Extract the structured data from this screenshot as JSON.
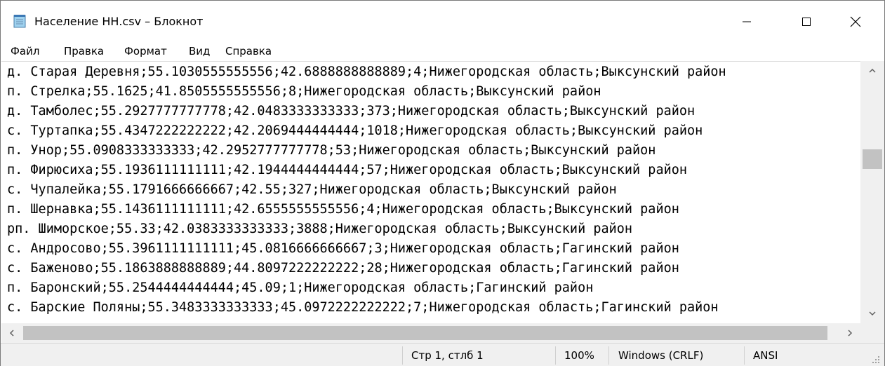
{
  "window": {
    "title": "Население НН.csv – Блокнот",
    "icon": "notepad-icon"
  },
  "menu": [
    "Файл",
    "Правка",
    "Формат",
    "Вид",
    "Справка"
  ],
  "lines": [
    "д. Старая Деревня;55.1030555555556;42.6888888888889;4;Нижегородская область;Выксунский район",
    "п. Стрелка;55.1625;41.8505555555556;8;Нижегородская область;Выксунский район",
    "д. Тамболес;55.2927777777778;42.0483333333333;373;Нижегородская область;Выксунский район",
    "с. Туртапка;55.4347222222222;42.2069444444444;1018;Нижегородская область;Выксунский район",
    "п. Унор;55.0908333333333;42.2952777777778;53;Нижегородская область;Выксунский район",
    "п. Фирюсиха;55.1936111111111;42.1944444444444;57;Нижегородская область;Выксунский район",
    "с. Чупалейка;55.1791666666667;42.55;327;Нижегородская область;Выксунский район",
    "п. Шернавка;55.1436111111111;42.6555555555556;4;Нижегородская область;Выксунский район",
    "рп. Шиморское;55.33;42.0383333333333;3888;Нижегородская область;Выксунский район",
    "с. Андросово;55.3961111111111;45.0816666666667;3;Нижегородская область;Гагинский район",
    "с. Баженово;55.1863888888889;44.8097222222222;28;Нижегородская область;Гагинский район",
    "п. Баронский;55.2544444444444;45.09;1;Нижегородская область;Гагинский район",
    "с. Барские Поляны;55.3483333333333;45.0972222222222;7;Нижегородская область;Гагинский район"
  ],
  "status": {
    "position": "Стр 1, стлб 1",
    "zoom": "100%",
    "line_endings": "Windows (CRLF)",
    "encoding": "ANSI"
  }
}
